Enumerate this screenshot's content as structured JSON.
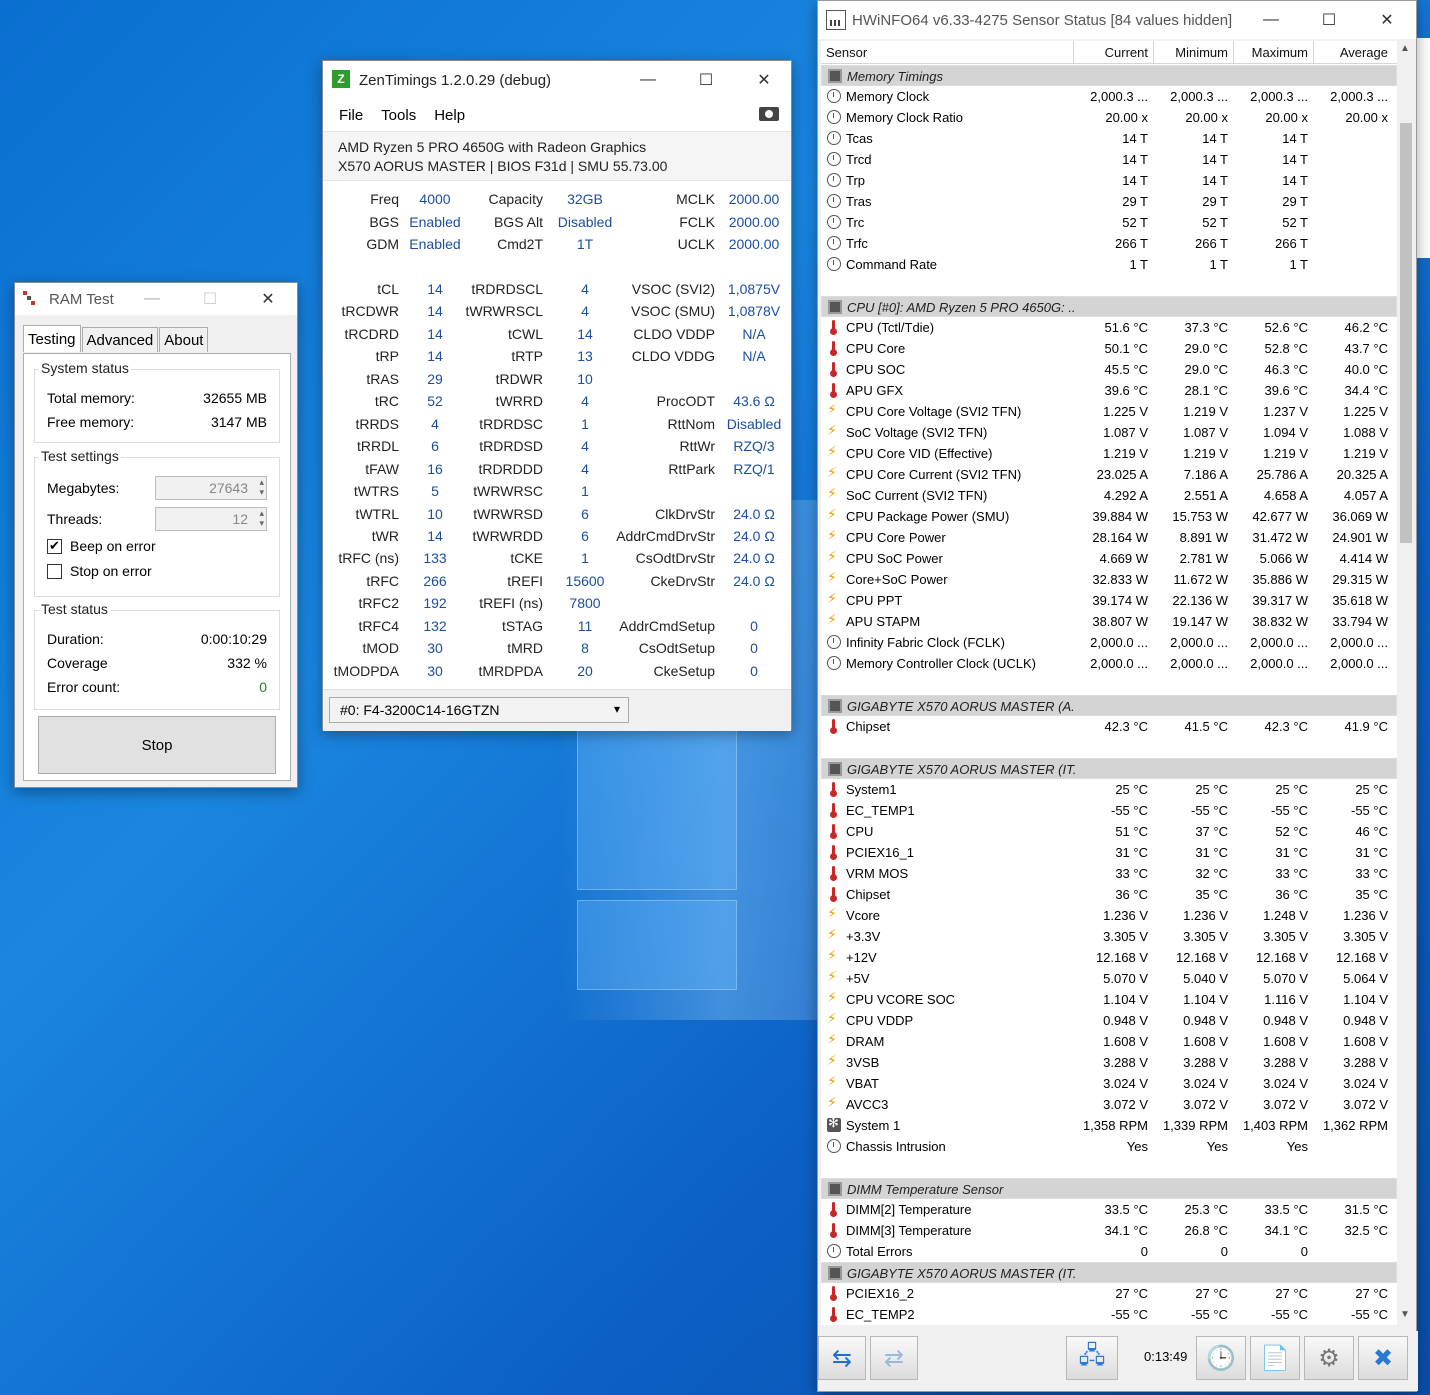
{
  "ramtest": {
    "title": "RAM Test",
    "tabs": [
      "Testing",
      "Advanced",
      "About"
    ],
    "system_status": {
      "title": "System status",
      "total_label": "Total memory:",
      "total_value": "32655 MB",
      "free_label": "Free memory:",
      "free_value": "3147 MB"
    },
    "test_settings": {
      "title": "Test settings",
      "megabytes_label": "Megabytes:",
      "megabytes_value": "27643",
      "threads_label": "Threads:",
      "threads_value": "12",
      "beep_label": "Beep on error",
      "beep_checked": true,
      "stop_label": "Stop on error",
      "stop_checked": false
    },
    "test_status": {
      "title": "Test status",
      "duration_label": "Duration:",
      "duration_value": "0:00:10:29",
      "coverage_label": "Coverage",
      "coverage_value": "332 %",
      "errors_label": "Error count:",
      "errors_value": "0"
    },
    "stop_button": "Stop"
  },
  "zen": {
    "title": "ZenTimings 1.2.0.29 (debug)",
    "logo": "Z",
    "menu": [
      "File",
      "Tools",
      "Help"
    ],
    "cpu": "AMD Ryzen 5 PRO 4650G with Radeon Graphics",
    "board": "X570 AORUS MASTER | BIOS F31d | SMU 55.73.00",
    "top": [
      [
        "Freq",
        "4000",
        "Capacity",
        "32GB",
        "MCLK",
        "2000.00"
      ],
      [
        "BGS",
        "Enabled",
        "BGS Alt",
        "Disabled",
        "FCLK",
        "2000.00"
      ],
      [
        "GDM",
        "Enabled",
        "Cmd2T",
        "1T",
        "UCLK",
        "2000.00"
      ]
    ],
    "timings": [
      [
        "tCL",
        "14",
        "tRDRDSCL",
        "4",
        "VSOC (SVI2)",
        "1,0875V"
      ],
      [
        "tRCDWR",
        "14",
        "tWRWRSCL",
        "4",
        "VSOC (SMU)",
        "1,0878V"
      ],
      [
        "tRCDRD",
        "14",
        "tCWL",
        "14",
        "CLDO VDDP",
        "N/A"
      ],
      [
        "tRP",
        "14",
        "tRTP",
        "13",
        "CLDO VDDG",
        "N/A"
      ],
      [
        "tRAS",
        "29",
        "tRDWR",
        "10",
        "",
        ""
      ],
      [
        "tRC",
        "52",
        "tWRRD",
        "4",
        "ProcODT",
        "43.6 Ω"
      ],
      [
        "tRRDS",
        "4",
        "tRDRDSC",
        "1",
        "RttNom",
        "Disabled"
      ],
      [
        "tRRDL",
        "6",
        "tRDRDSD",
        "4",
        "RttWr",
        "RZQ/3"
      ],
      [
        "tFAW",
        "16",
        "tRDRDDD",
        "4",
        "RttPark",
        "RZQ/1"
      ],
      [
        "tWTRS",
        "5",
        "tWRWRSC",
        "1",
        "",
        ""
      ],
      [
        "tWTRL",
        "10",
        "tWRWRSD",
        "6",
        "ClkDrvStr",
        "24.0 Ω"
      ],
      [
        "tWR",
        "14",
        "tWRWRDD",
        "6",
        "AddrCmdDrvStr",
        "24.0 Ω"
      ],
      [
        "tRFC (ns)",
        "133",
        "tCKE",
        "1",
        "CsOdtDrvStr",
        "24.0 Ω"
      ],
      [
        "tRFC",
        "266",
        "tREFI",
        "15600",
        "CkeDrvStr",
        "24.0 Ω"
      ],
      [
        "tRFC2",
        "192",
        "tREFI (ns)",
        "7800",
        "",
        ""
      ],
      [
        "tRFC4",
        "132",
        "tSTAG",
        "11",
        "AddrCmdSetup",
        "0"
      ],
      [
        "tMOD",
        "30",
        "tMRD",
        "8",
        "CsOdtSetup",
        "0"
      ],
      [
        "tMODPDA",
        "30",
        "tMRDPDA",
        "20",
        "CkeSetup",
        "0"
      ]
    ],
    "dimm_select": "#0: F4-3200C14-16GTZN"
  },
  "hw": {
    "title": "HWiNFO64 v6.33-4275 Sensor Status [84 values hidden]",
    "columns": [
      "Sensor",
      "Current",
      "Minimum",
      "Maximum",
      "Average"
    ],
    "timer": "0:13:49",
    "rows": [
      {
        "g": "Memory Timings"
      },
      {
        "i": "clock",
        "n": "Memory Clock",
        "v": [
          "2,000.3 ...",
          "2,000.3 ...",
          "2,000.3 ...",
          "2,000.3 ..."
        ]
      },
      {
        "i": "clock",
        "n": "Memory Clock Ratio",
        "v": [
          "20.00 x",
          "20.00 x",
          "20.00 x",
          "20.00 x"
        ]
      },
      {
        "i": "clock",
        "n": "Tcas",
        "v": [
          "14 T",
          "14 T",
          "14 T",
          ""
        ]
      },
      {
        "i": "clock",
        "n": "Trcd",
        "v": [
          "14 T",
          "14 T",
          "14 T",
          ""
        ]
      },
      {
        "i": "clock",
        "n": "Trp",
        "v": [
          "14 T",
          "14 T",
          "14 T",
          ""
        ]
      },
      {
        "i": "clock",
        "n": "Tras",
        "v": [
          "29 T",
          "29 T",
          "29 T",
          ""
        ]
      },
      {
        "i": "clock",
        "n": "Trc",
        "v": [
          "52 T",
          "52 T",
          "52 T",
          ""
        ]
      },
      {
        "i": "clock",
        "n": "Trfc",
        "v": [
          "266 T",
          "266 T",
          "266 T",
          ""
        ]
      },
      {
        "i": "clock",
        "n": "Command Rate",
        "v": [
          "1 T",
          "1 T",
          "1 T",
          ""
        ]
      },
      {
        "blank": true
      },
      {
        "g": "CPU [#0]: AMD Ryzen 5 PRO 4650G: ..."
      },
      {
        "i": "therm",
        "n": "CPU (Tctl/Tdie)",
        "v": [
          "51.6 °C",
          "37.3 °C",
          "52.6 °C",
          "46.2 °C"
        ]
      },
      {
        "i": "therm",
        "n": "CPU Core",
        "v": [
          "50.1 °C",
          "29.0 °C",
          "52.8 °C",
          "43.7 °C"
        ]
      },
      {
        "i": "therm",
        "n": "CPU SOC",
        "v": [
          "45.5 °C",
          "29.0 °C",
          "46.3 °C",
          "40.0 °C"
        ]
      },
      {
        "i": "therm",
        "n": "APU GFX",
        "v": [
          "39.6 °C",
          "28.1 °C",
          "39.6 °C",
          "34.4 °C"
        ]
      },
      {
        "i": "bolt",
        "n": "CPU Core Voltage (SVI2 TFN)",
        "v": [
          "1.225 V",
          "1.219 V",
          "1.237 V",
          "1.225 V"
        ]
      },
      {
        "i": "bolt",
        "n": "SoC Voltage (SVI2 TFN)",
        "v": [
          "1.087 V",
          "1.087 V",
          "1.094 V",
          "1.088 V"
        ]
      },
      {
        "i": "bolt",
        "n": "CPU Core VID (Effective)",
        "v": [
          "1.219 V",
          "1.219 V",
          "1.219 V",
          "1.219 V"
        ]
      },
      {
        "i": "bolt",
        "n": "CPU Core Current (SVI2 TFN)",
        "v": [
          "23.025 A",
          "7.186 A",
          "25.786 A",
          "20.325 A"
        ]
      },
      {
        "i": "bolt",
        "n": "SoC Current (SVI2 TFN)",
        "v": [
          "4.292 A",
          "2.551 A",
          "4.658 A",
          "4.057 A"
        ]
      },
      {
        "i": "bolt",
        "n": "CPU Package Power (SMU)",
        "v": [
          "39.884 W",
          "15.753 W",
          "42.677 W",
          "36.069 W"
        ]
      },
      {
        "i": "bolt",
        "n": "CPU Core Power",
        "v": [
          "28.164 W",
          "8.891 W",
          "31.472 W",
          "24.901 W"
        ]
      },
      {
        "i": "bolt",
        "n": "CPU SoC Power",
        "v": [
          "4.669 W",
          "2.781 W",
          "5.066 W",
          "4.414 W"
        ]
      },
      {
        "i": "bolt",
        "n": "Core+SoC Power",
        "v": [
          "32.833 W",
          "11.672 W",
          "35.886 W",
          "29.315 W"
        ]
      },
      {
        "i": "bolt",
        "n": "CPU PPT",
        "v": [
          "39.174 W",
          "22.136 W",
          "39.317 W",
          "35.618 W"
        ]
      },
      {
        "i": "bolt",
        "n": "APU STAPM",
        "v": [
          "38.807 W",
          "19.147 W",
          "38.832 W",
          "33.794 W"
        ]
      },
      {
        "i": "clock",
        "n": "Infinity Fabric Clock (FCLK)",
        "v": [
          "2,000.0 ...",
          "2,000.0 ...",
          "2,000.0 ...",
          "2,000.0 ..."
        ]
      },
      {
        "i": "clock",
        "n": "Memory Controller Clock (UCLK)",
        "v": [
          "2,000.0 ...",
          "2,000.0 ...",
          "2,000.0 ...",
          "2,000.0 ..."
        ]
      },
      {
        "blank": true
      },
      {
        "g": "GIGABYTE X570 AORUS MASTER (A..."
      },
      {
        "i": "therm",
        "n": "Chipset",
        "v": [
          "42.3 °C",
          "41.5 °C",
          "42.3 °C",
          "41.9 °C"
        ]
      },
      {
        "blank": true
      },
      {
        "g": "GIGABYTE X570 AORUS MASTER (IT..."
      },
      {
        "i": "therm",
        "n": "System1",
        "v": [
          "25 °C",
          "25 °C",
          "25 °C",
          "25 °C"
        ]
      },
      {
        "i": "therm",
        "n": "EC_TEMP1",
        "v": [
          "-55 °C",
          "-55 °C",
          "-55 °C",
          "-55 °C"
        ]
      },
      {
        "i": "therm",
        "n": "CPU",
        "v": [
          "51 °C",
          "37 °C",
          "52 °C",
          "46 °C"
        ]
      },
      {
        "i": "therm",
        "n": "PCIEX16_1",
        "v": [
          "31 °C",
          "31 °C",
          "31 °C",
          "31 °C"
        ]
      },
      {
        "i": "therm",
        "n": "VRM MOS",
        "v": [
          "33 °C",
          "32 °C",
          "33 °C",
          "33 °C"
        ]
      },
      {
        "i": "therm",
        "n": "Chipset",
        "v": [
          "36 °C",
          "35 °C",
          "36 °C",
          "35 °C"
        ]
      },
      {
        "i": "bolt",
        "n": "Vcore",
        "v": [
          "1.236 V",
          "1.236 V",
          "1.248 V",
          "1.236 V"
        ]
      },
      {
        "i": "bolt",
        "n": "+3.3V",
        "v": [
          "3.305 V",
          "3.305 V",
          "3.305 V",
          "3.305 V"
        ]
      },
      {
        "i": "bolt",
        "n": "+12V",
        "v": [
          "12.168 V",
          "12.168 V",
          "12.168 V",
          "12.168 V"
        ]
      },
      {
        "i": "bolt",
        "n": "+5V",
        "v": [
          "5.070 V",
          "5.040 V",
          "5.070 V",
          "5.064 V"
        ]
      },
      {
        "i": "bolt",
        "n": "CPU VCORE SOC",
        "v": [
          "1.104 V",
          "1.104 V",
          "1.116 V",
          "1.104 V"
        ]
      },
      {
        "i": "bolt",
        "n": "CPU VDDP",
        "v": [
          "0.948 V",
          "0.948 V",
          "0.948 V",
          "0.948 V"
        ]
      },
      {
        "i": "bolt",
        "n": "DRAM",
        "v": [
          "1.608 V",
          "1.608 V",
          "1.608 V",
          "1.608 V"
        ]
      },
      {
        "i": "bolt",
        "n": "3VSB",
        "v": [
          "3.288 V",
          "3.288 V",
          "3.288 V",
          "3.288 V"
        ]
      },
      {
        "i": "bolt",
        "n": "VBAT",
        "v": [
          "3.024 V",
          "3.024 V",
          "3.024 V",
          "3.024 V"
        ]
      },
      {
        "i": "bolt",
        "n": "AVCC3",
        "v": [
          "3.072 V",
          "3.072 V",
          "3.072 V",
          "3.072 V"
        ]
      },
      {
        "i": "fan",
        "n": "System 1",
        "v": [
          "1,358 RPM",
          "1,339 RPM",
          "1,403 RPM",
          "1,362 RPM"
        ]
      },
      {
        "i": "clock",
        "n": "Chassis Intrusion",
        "v": [
          "Yes",
          "Yes",
          "Yes",
          ""
        ]
      },
      {
        "blank": true
      },
      {
        "g": "DIMM Temperature Sensor"
      },
      {
        "i": "therm",
        "n": "DIMM[2] Temperature",
        "v": [
          "33.5 °C",
          "25.3 °C",
          "33.5 °C",
          "31.5 °C"
        ]
      },
      {
        "i": "therm",
        "n": "DIMM[3] Temperature",
        "v": [
          "34.1 °C",
          "26.8 °C",
          "34.1 °C",
          "32.5 °C"
        ]
      },
      {
        "i": "clock",
        "n": "Total Errors",
        "v": [
          "0",
          "0",
          "0",
          ""
        ]
      },
      {
        "g": "GIGABYTE X570 AORUS MASTER (IT..."
      },
      {
        "i": "therm",
        "n": "PCIEX16_2",
        "v": [
          "27 °C",
          "27 °C",
          "27 °C",
          "27 °C"
        ]
      },
      {
        "i": "therm",
        "n": "EC_TEMP2",
        "v": [
          "-55 °C",
          "-55 °C",
          "-55 °C",
          "-55 °C"
        ]
      }
    ]
  }
}
